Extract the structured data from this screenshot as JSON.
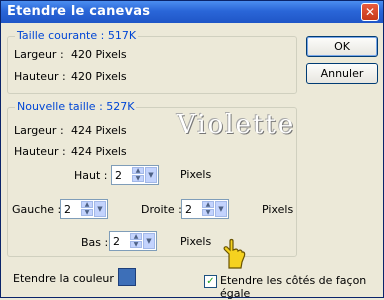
{
  "window": {
    "title": "Etendre le canevas"
  },
  "buttons": {
    "ok": "OK",
    "cancel": "Annuler"
  },
  "current_size": {
    "legend": "Taille courante : 517K",
    "width_label": "Largeur :",
    "width_value": "420 Pixels",
    "height_label": "Hauteur :",
    "height_value": "420 Pixels"
  },
  "new_size": {
    "legend": "Nouvelle taille : 527K",
    "width_label": "Largeur :",
    "width_value": "424 Pixels",
    "height_label": "Hauteur :",
    "height_value": "424 Pixels",
    "watermark": "Violette",
    "top": {
      "label": "Haut :",
      "value": "2",
      "unit": "Pixels"
    },
    "left": {
      "label": "Gauche :",
      "value": "2"
    },
    "right": {
      "label": "Droite :",
      "value": "2",
      "unit": "Pixels"
    },
    "bottom": {
      "label": "Bas :",
      "value": "2",
      "unit": "Pixels"
    }
  },
  "fill_color": {
    "label": "Etendre la couleur :",
    "color": "#3d6fb8"
  },
  "expand_sides": {
    "label": "Etendre les côtés de façon égale",
    "checked": true
  }
}
